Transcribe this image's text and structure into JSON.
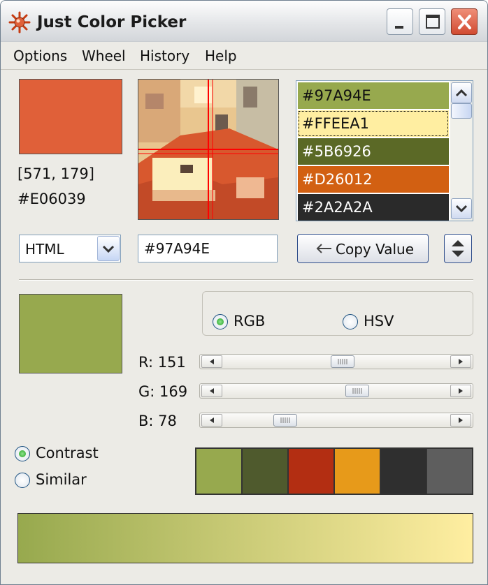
{
  "window": {
    "title": "Just Color Picker",
    "icon": "color-picker-icon"
  },
  "menu": [
    {
      "label": "Options"
    },
    {
      "label": "Wheel"
    },
    {
      "label": "History"
    },
    {
      "label": "Help"
    }
  ],
  "picked": {
    "color": "#E06039",
    "coords": "[571, 179]",
    "hex": "#E06039"
  },
  "history": [
    {
      "label": "#97A94E",
      "color": "#97A94E",
      "text_color": "#111111"
    },
    {
      "label": "#FFEEA1",
      "color": "#FFEEA1",
      "text_color": "#111111"
    },
    {
      "label": "#5B6926",
      "color": "#5B6926",
      "text_color": "#ffffff"
    },
    {
      "label": "#D26012",
      "color": "#D26012",
      "text_color": "#ffffff"
    },
    {
      "label": "#2A2A2A",
      "color": "#2A2A2A",
      "text_color": "#ffffff"
    }
  ],
  "format": {
    "value": "HTML"
  },
  "hex_input": {
    "value": "#97A94E"
  },
  "copy_button": {
    "label": "Copy Value"
  },
  "selected": {
    "color": "#97A94E"
  },
  "mode": {
    "options": [
      "RGB",
      "HSV"
    ],
    "selected": "RGB"
  },
  "channels": [
    {
      "label": "R: 151",
      "value": 151,
      "max": 255
    },
    {
      "label": "G: 169",
      "value": 169,
      "max": 255
    },
    {
      "label": "B: 78",
      "value": 78,
      "max": 255
    }
  ],
  "scheme": {
    "options": [
      "Contrast",
      "Similar"
    ],
    "selected": "Contrast"
  },
  "palette": [
    "#97A94E",
    "#4F5A2D",
    "#B32E12",
    "#E79A1A",
    "#2F2F2F",
    "#5E5E5E"
  ],
  "gradient": {
    "from": "#97A94E",
    "to": "#FFEEA1"
  }
}
